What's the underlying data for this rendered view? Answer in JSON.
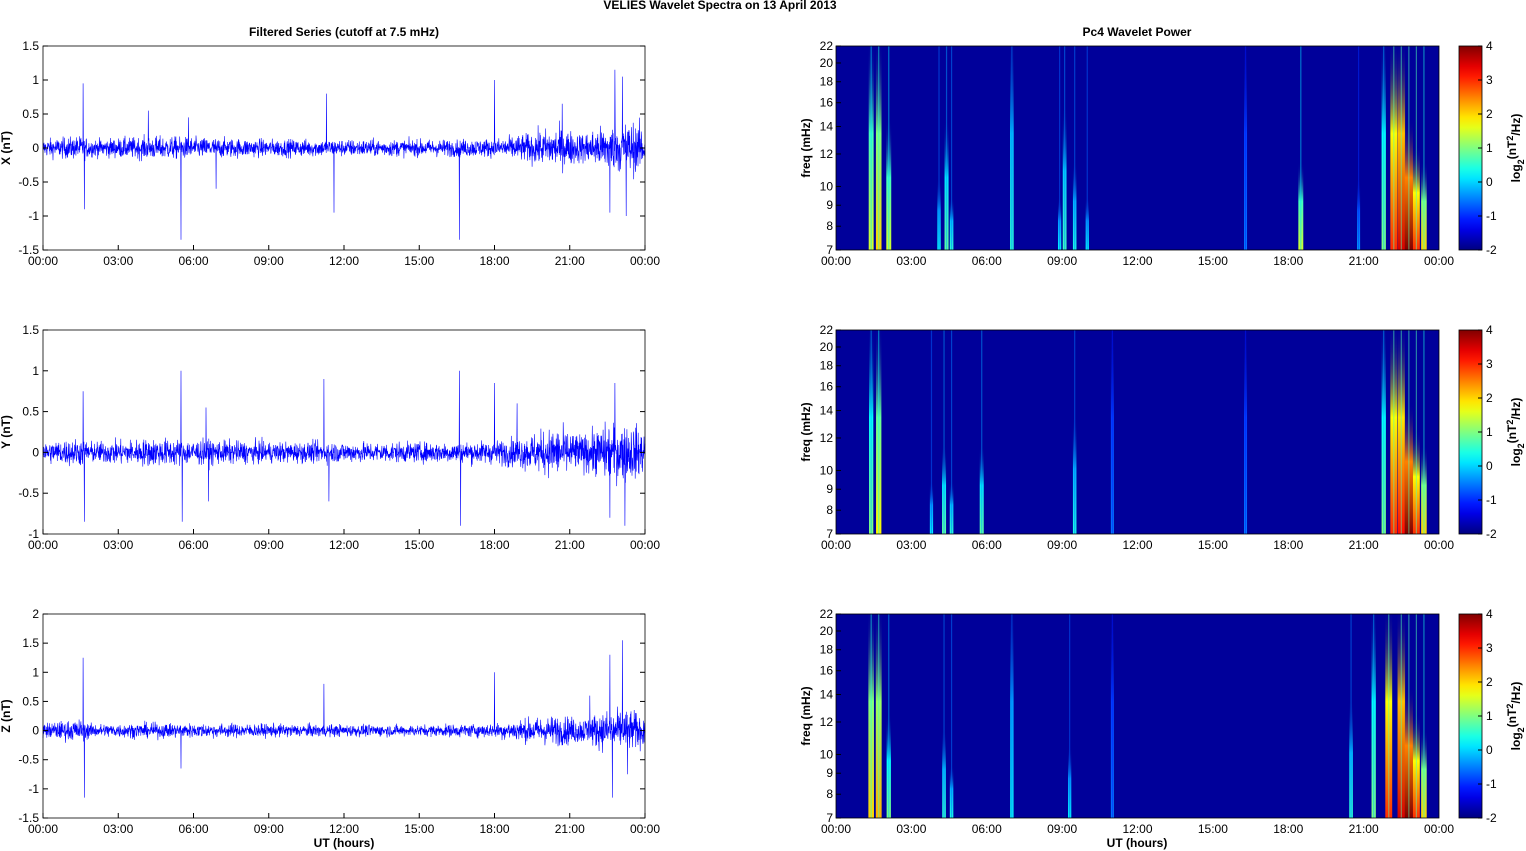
{
  "title": "VELIES Wavelet Spectra on 13 April     2013",
  "chart_data": {
    "type": "line",
    "left_title": "Filtered Series (cutoff at 7.5 mHz)",
    "right_title": "Pc4 Wavelet Power",
    "xlabel": "UT (hours)",
    "x_ticks": [
      "00:00",
      "03:00",
      "06:00",
      "09:00",
      "12:00",
      "15:00",
      "18:00",
      "21:00",
      "00:00"
    ],
    "xlim": [
      0,
      24
    ],
    "freq_label": "freq (mHz)",
    "freq_ticks": [
      7,
      8,
      9,
      10,
      12,
      14,
      16,
      18,
      20,
      22
    ],
    "freq_lim": [
      7,
      22
    ],
    "colorbar": {
      "label_parts": [
        "log",
        "2",
        "(nT",
        "2",
        "/Hz)"
      ],
      "ticks": [
        4,
        3,
        2,
        1,
        0,
        -1,
        -2
      ],
      "lim": [
        -2,
        4
      ],
      "colormap": "jet"
    },
    "series": [
      {
        "name": "X",
        "ylabel": "X (nT)",
        "ylim": [
          -1.5,
          1.5
        ],
        "yticks": [
          "1.5",
          "1",
          "0.5",
          "0",
          "-0.5",
          "-1",
          "-1.5"
        ],
        "yvals": [
          1.5,
          1,
          0.5,
          0,
          -0.5,
          -1,
          -1.5
        ],
        "envelope": [
          [
            0,
            0.15
          ],
          [
            1.5,
            0.2
          ],
          [
            2,
            0.15
          ],
          [
            4.5,
            0.2
          ],
          [
            6,
            0.18
          ],
          [
            9,
            0.15
          ],
          [
            15,
            0.14
          ],
          [
            18,
            0.16
          ],
          [
            19,
            0.22
          ],
          [
            20.5,
            0.35
          ],
          [
            21.5,
            0.25
          ],
          [
            22.5,
            0.4
          ],
          [
            23.5,
            0.45
          ],
          [
            24,
            0.35
          ]
        ],
        "spikes": [
          [
            1.6,
            0.95
          ],
          [
            1.65,
            -0.9
          ],
          [
            4.2,
            0.55
          ],
          [
            5.5,
            -1.35
          ],
          [
            5.8,
            0.45
          ],
          [
            6.9,
            -0.6
          ],
          [
            11.3,
            0.8
          ],
          [
            11.6,
            -0.95
          ],
          [
            16.6,
            -1.35
          ],
          [
            18,
            1.0
          ],
          [
            20.7,
            0.65
          ],
          [
            22.6,
            -0.95
          ],
          [
            22.8,
            1.15
          ],
          [
            23.1,
            1.05
          ],
          [
            23.25,
            -1.0
          ]
        ],
        "spectrum": [
          [
            1.4,
            22,
            1.5
          ],
          [
            1.7,
            22,
            2.0
          ],
          [
            2.1,
            14,
            1.5
          ],
          [
            4.1,
            10,
            0.3
          ],
          [
            4.4,
            14,
            0.8
          ],
          [
            4.6,
            9,
            0.5
          ],
          [
            7.0,
            22,
            0.5
          ],
          [
            8.9,
            9,
            0.2
          ],
          [
            9.1,
            15,
            0.6
          ],
          [
            9.5,
            11,
            0.4
          ],
          [
            10.0,
            9,
            0.2
          ],
          [
            16.3,
            22,
            -0.5
          ],
          [
            18.5,
            11,
            1.5
          ],
          [
            20.8,
            10,
            -0.3
          ],
          [
            21.8,
            22,
            1.0
          ],
          [
            22.2,
            22,
            3.0
          ],
          [
            22.5,
            22,
            3.5
          ],
          [
            22.8,
            14,
            4.0
          ],
          [
            23.1,
            12,
            3.0
          ],
          [
            23.4,
            11,
            2.0
          ]
        ]
      },
      {
        "name": "Y",
        "ylabel": "Y (nT)",
        "ylim": [
          -1,
          1.5
        ],
        "yticks": [
          "1.5",
          "1",
          "0.5",
          "0",
          "-0.5",
          "-1"
        ],
        "yvals": [
          1.5,
          1,
          0.5,
          0,
          -0.5,
          -1
        ],
        "envelope": [
          [
            0,
            0.15
          ],
          [
            1.5,
            0.2
          ],
          [
            2,
            0.15
          ],
          [
            4.5,
            0.2
          ],
          [
            6,
            0.18
          ],
          [
            9,
            0.15
          ],
          [
            15,
            0.14
          ],
          [
            18,
            0.16
          ],
          [
            19,
            0.22
          ],
          [
            20.5,
            0.35
          ],
          [
            21.5,
            0.25
          ],
          [
            22.5,
            0.4
          ],
          [
            23.5,
            0.4
          ],
          [
            24,
            0.3
          ]
        ],
        "spikes": [
          [
            1.6,
            0.75
          ],
          [
            1.65,
            -0.85
          ],
          [
            5.5,
            1.0
          ],
          [
            5.55,
            -0.85
          ],
          [
            6.5,
            0.55
          ],
          [
            6.6,
            -0.6
          ],
          [
            11.2,
            0.9
          ],
          [
            11.4,
            -0.6
          ],
          [
            16.6,
            1.0
          ],
          [
            16.65,
            -0.9
          ],
          [
            18,
            0.85
          ],
          [
            18.9,
            0.6
          ],
          [
            22.6,
            -0.8
          ],
          [
            22.8,
            0.85
          ],
          [
            23.2,
            -0.9
          ]
        ],
        "spectrum": [
          [
            1.4,
            22,
            1.0
          ],
          [
            1.7,
            22,
            1.8
          ],
          [
            3.8,
            9,
            0.2
          ],
          [
            4.3,
            11,
            0.8
          ],
          [
            4.6,
            9,
            0.5
          ],
          [
            5.8,
            11,
            0.8
          ],
          [
            9.5,
            13,
            0.4
          ],
          [
            11.0,
            22,
            -0.5
          ],
          [
            16.3,
            22,
            -0.5
          ],
          [
            21.8,
            22,
            1.0
          ],
          [
            22.2,
            22,
            3.0
          ],
          [
            22.5,
            22,
            3.2
          ],
          [
            22.8,
            14,
            4.0
          ],
          [
            23.1,
            12,
            3.0
          ],
          [
            23.4,
            11,
            2.0
          ]
        ]
      },
      {
        "name": "Z",
        "ylabel": "Z (nT)",
        "ylim": [
          -1.5,
          2
        ],
        "yticks": [
          "2",
          "1.5",
          "1",
          "0.5",
          "0",
          "-0.5",
          "-1",
          "-1.5"
        ],
        "yvals": [
          2,
          1.5,
          1,
          0.5,
          0,
          -0.5,
          -1,
          -1.5
        ],
        "envelope": [
          [
            0,
            0.15
          ],
          [
            1.5,
            0.22
          ],
          [
            2,
            0.13
          ],
          [
            4.5,
            0.15
          ],
          [
            6,
            0.14
          ],
          [
            9,
            0.13
          ],
          [
            15,
            0.11
          ],
          [
            18,
            0.14
          ],
          [
            19,
            0.22
          ],
          [
            20.5,
            0.3
          ],
          [
            21.5,
            0.25
          ],
          [
            22.5,
            0.4
          ],
          [
            23.5,
            0.4
          ],
          [
            24,
            0.3
          ]
        ],
        "spikes": [
          [
            1.6,
            1.25
          ],
          [
            1.65,
            -1.15
          ],
          [
            5.5,
            -0.65
          ],
          [
            11.2,
            0.8
          ],
          [
            18,
            1.0
          ],
          [
            21.8,
            0.6
          ],
          [
            22.6,
            1.3
          ],
          [
            22.7,
            -1.15
          ],
          [
            23.1,
            1.55
          ],
          [
            23.3,
            -0.75
          ]
        ],
        "spectrum": [
          [
            1.4,
            22,
            2.0
          ],
          [
            1.7,
            22,
            2.2
          ],
          [
            2.1,
            12,
            1.0
          ],
          [
            4.3,
            11,
            0.5
          ],
          [
            4.6,
            9,
            0.4
          ],
          [
            7.0,
            22,
            0.3
          ],
          [
            9.3,
            10,
            0.2
          ],
          [
            11.0,
            22,
            -0.5
          ],
          [
            20.5,
            13,
            0.5
          ],
          [
            21.4,
            22,
            1.0
          ],
          [
            22.0,
            22,
            3.0
          ],
          [
            22.5,
            22,
            3.5
          ],
          [
            22.8,
            14,
            4.0
          ],
          [
            23.1,
            12,
            3.0
          ],
          [
            23.4,
            11,
            2.0
          ]
        ]
      }
    ]
  }
}
